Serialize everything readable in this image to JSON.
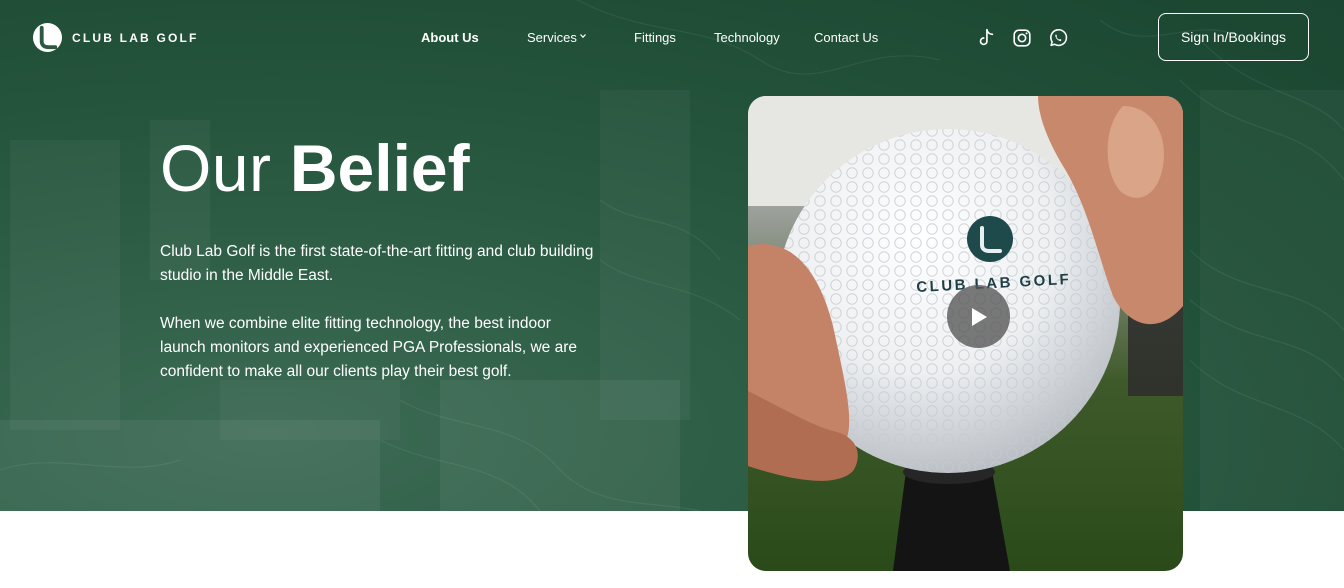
{
  "brand": {
    "name": "CLUB LAB GOLF"
  },
  "nav": {
    "items": [
      {
        "label": "About Us",
        "active": true
      },
      {
        "label": "Services",
        "active": false,
        "has_dropdown": true
      },
      {
        "label": "Fittings",
        "active": false
      },
      {
        "label": "Technology",
        "active": false
      },
      {
        "label": "Contact Us",
        "active": false
      }
    ],
    "social_icons": [
      "tiktok-icon",
      "instagram-icon",
      "whatsapp-icon"
    ],
    "signin_label": "Sign In/Bookings"
  },
  "hero": {
    "title_light": "Our",
    "title_bold": "Belief",
    "paragraphs": [
      "Club Lab Golf is the first state-of-the-art fitting and club building studio in the Middle East.",
      "When we combine elite fitting technology, the best indoor launch monitors and experienced PGA Professionals, we are confident to make all our clients play their best golf."
    ]
  },
  "video": {
    "ball_print": "CLUB LAB GOLF",
    "play_icon": "play-icon"
  },
  "colors": {
    "hero_green": "#1f4d36",
    "text": "#ffffff",
    "page_background": "#ffffff"
  }
}
